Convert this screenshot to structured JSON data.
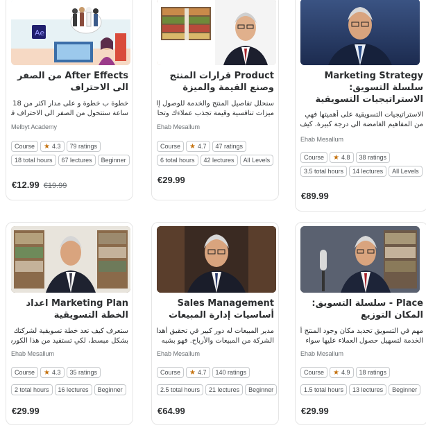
{
  "courses": [
    {
      "title": "After Effects من الصفر الى الاحتراف",
      "desc1": "خطوة ب خطوة و على مدار اكثر من 18",
      "desc2": "ساعة ستتحول من الصفر الى الاحتراف في",
      "instructor": "Melbyt Academy",
      "type": "Course",
      "rating": "4.3",
      "ratings_count": "79 ratings",
      "hours": "18 total hours",
      "lectures": "67 lectures",
      "level": "Beginner",
      "price": "€12.99",
      "old_price": "€19.99"
    },
    {
      "title": "Product قرارات المنتج وصنع القيمة والميزة التنافسية",
      "desc1": "سنحلل تفاصيل المنتج والخدمة للوصول إلى",
      "desc2": "ميزات تنافسية وقيمة تجذب عملاءك وتحافظ",
      "instructor": "Ehab Mesallum",
      "type": "Course",
      "rating": "4.7",
      "ratings_count": "47 ratings",
      "hours": "6 total hours",
      "lectures": "42 lectures",
      "level": "All Levels",
      "price": "€29.99",
      "old_price": ""
    },
    {
      "title": "Marketing Strategy سلسلة التسويق: الاستراتيجيات التسويقية",
      "desc1": "الاستراتيجيات التسويقية على أهميتها فهي",
      "desc2": "من المفاهيم الغامضة الى درجة كبيرة. كيف",
      "instructor": "Ehab Mesallum",
      "type": "Course",
      "rating": "4.8",
      "ratings_count": "38 ratings",
      "hours": "3.5 total hours",
      "lectures": "14 lectures",
      "level": "All Levels",
      "price": "€89.99",
      "old_price": ""
    },
    {
      "title": "Marketing Plan اعداد الخطة التسويقية",
      "desc1": "ستعرف كيف تعد خطة تسويقية لشركتك",
      "desc2": "بشكل مبسط، لكي تستفيد من هذا الكورس",
      "instructor": "Ehab Mesallum",
      "type": "Course",
      "rating": "4.3",
      "ratings_count": "35 ratings",
      "hours": "2 total hours",
      "lectures": "16 lectures",
      "level": "Beginner",
      "price": "€29.99",
      "old_price": ""
    },
    {
      "title": "Sales Management أساسيات إدارة المبيعات",
      "desc1": "مدير المبيعات له دور كبير في تحقيق أهداف",
      "desc2": "الشركة من المبيعات والأرباح. فهو بشبه",
      "instructor": "Ehab Mesallum",
      "type": "Course",
      "rating": "4.7",
      "ratings_count": "140 ratings",
      "hours": "2.5 total hours",
      "lectures": "21 lectures",
      "level": "Beginner",
      "price": "€64.99",
      "old_price": ""
    },
    {
      "title": "Place - سلسلة التسويق: المكان التوزيع",
      "desc1": "مهم في التسويق تحديد مكان وجود المنتج أو",
      "desc2": "الخدمة لتسهيل حصول العملاء عليها سواء",
      "instructor": "Ehab Mesallum",
      "type": "Course",
      "rating": "4.9",
      "ratings_count": "18 ratings",
      "hours": "1.5 total hours",
      "lectures": "13 lectures",
      "level": "Beginner",
      "price": "€29.99",
      "old_price": ""
    }
  ],
  "ae_logo": "Ae",
  "icons": {
    "rating": "star-icon"
  },
  "colors": {
    "star": "#c4710d",
    "ae_logo_bg": "#1f1f6e",
    "ae_logo_text": "#9999ff"
  }
}
